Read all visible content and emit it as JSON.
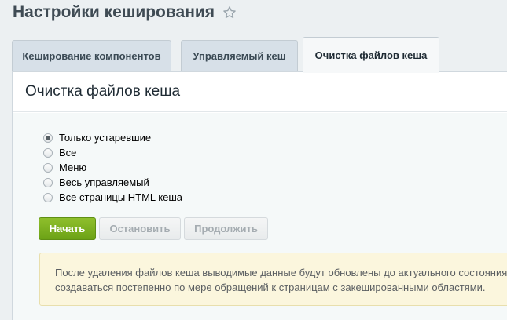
{
  "page": {
    "title": "Настройки кеширования",
    "favorite_icon": "star-icon"
  },
  "tabs": [
    {
      "label": "Кеширование компонентов",
      "active": false
    },
    {
      "label": "Управляемый кеш",
      "active": false
    },
    {
      "label": "Очистка файлов кеша",
      "active": true
    }
  ],
  "panel": {
    "title": "Очистка файлов кеша"
  },
  "options": [
    {
      "label": "Только устаревшие",
      "checked": true
    },
    {
      "label": "Все",
      "checked": false
    },
    {
      "label": "Меню",
      "checked": false
    },
    {
      "label": "Весь управляемый",
      "checked": false
    },
    {
      "label": "Все страницы HTML кеша",
      "checked": false
    }
  ],
  "buttons": {
    "start": "Начать",
    "stop": "Остановить",
    "continue": "Продолжить"
  },
  "notice": {
    "line1": "После удаления файлов кеша выводимые данные будут обновлены до актуального состояния.",
    "line2": "создаваться постепенно по мере обращений к страницам с закешированными областями."
  },
  "colors": {
    "primary_button": "#7cb01f",
    "notice_background": "#fbf6dd",
    "page_background": "#ecf0f2"
  }
}
